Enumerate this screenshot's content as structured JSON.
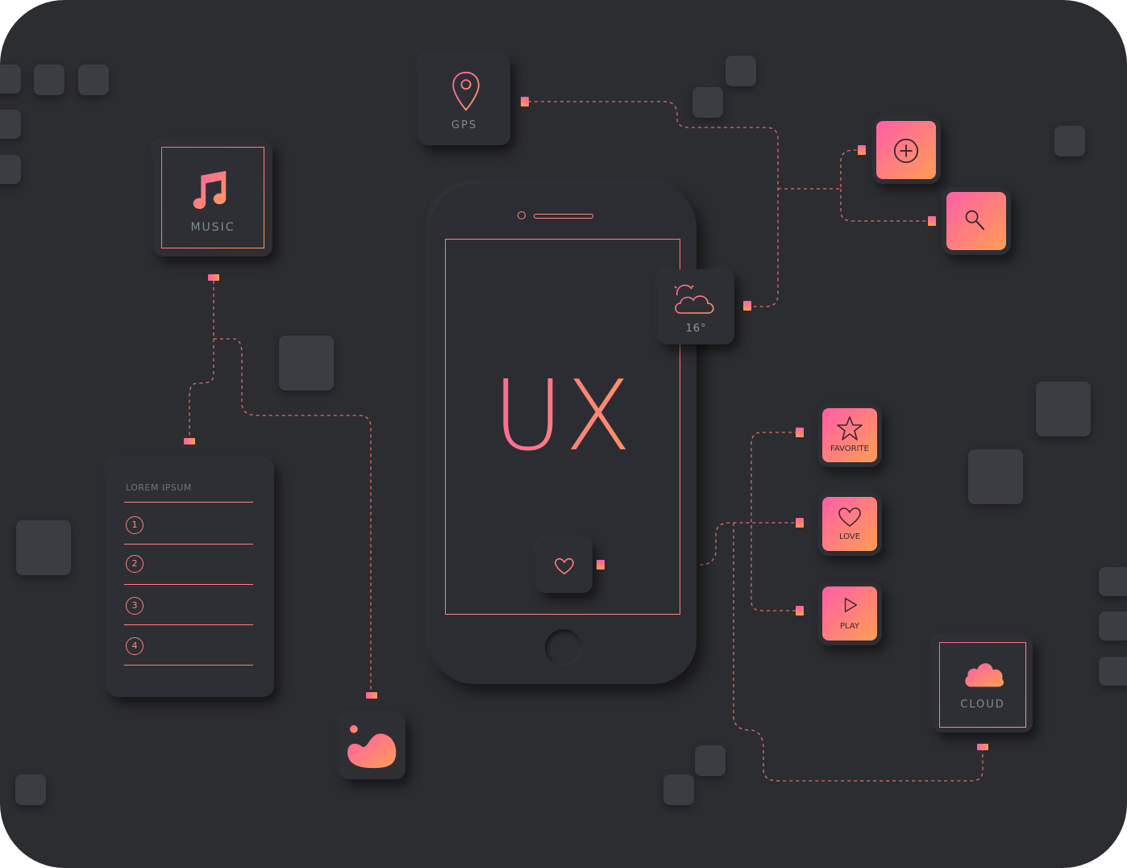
{
  "hero": {
    "text": "UX"
  },
  "gps": {
    "label": "GPS"
  },
  "music": {
    "label": "MUSIC"
  },
  "weather": {
    "temperature": "16°"
  },
  "list_card": {
    "title": "LOREM IPSUM",
    "items": [
      {
        "number": "1"
      },
      {
        "number": "2"
      },
      {
        "number": "3"
      },
      {
        "number": "4"
      }
    ]
  },
  "actions": {
    "favorite": "FAVORITE",
    "love": "LOVE",
    "play": "PLAY"
  },
  "cloud": {
    "label": "CLOUD"
  },
  "colors": {
    "background": "#2c2d31",
    "card": "#2e2f34",
    "accent_pink": "#ff5ea8",
    "accent_orange": "#ff9e53"
  }
}
